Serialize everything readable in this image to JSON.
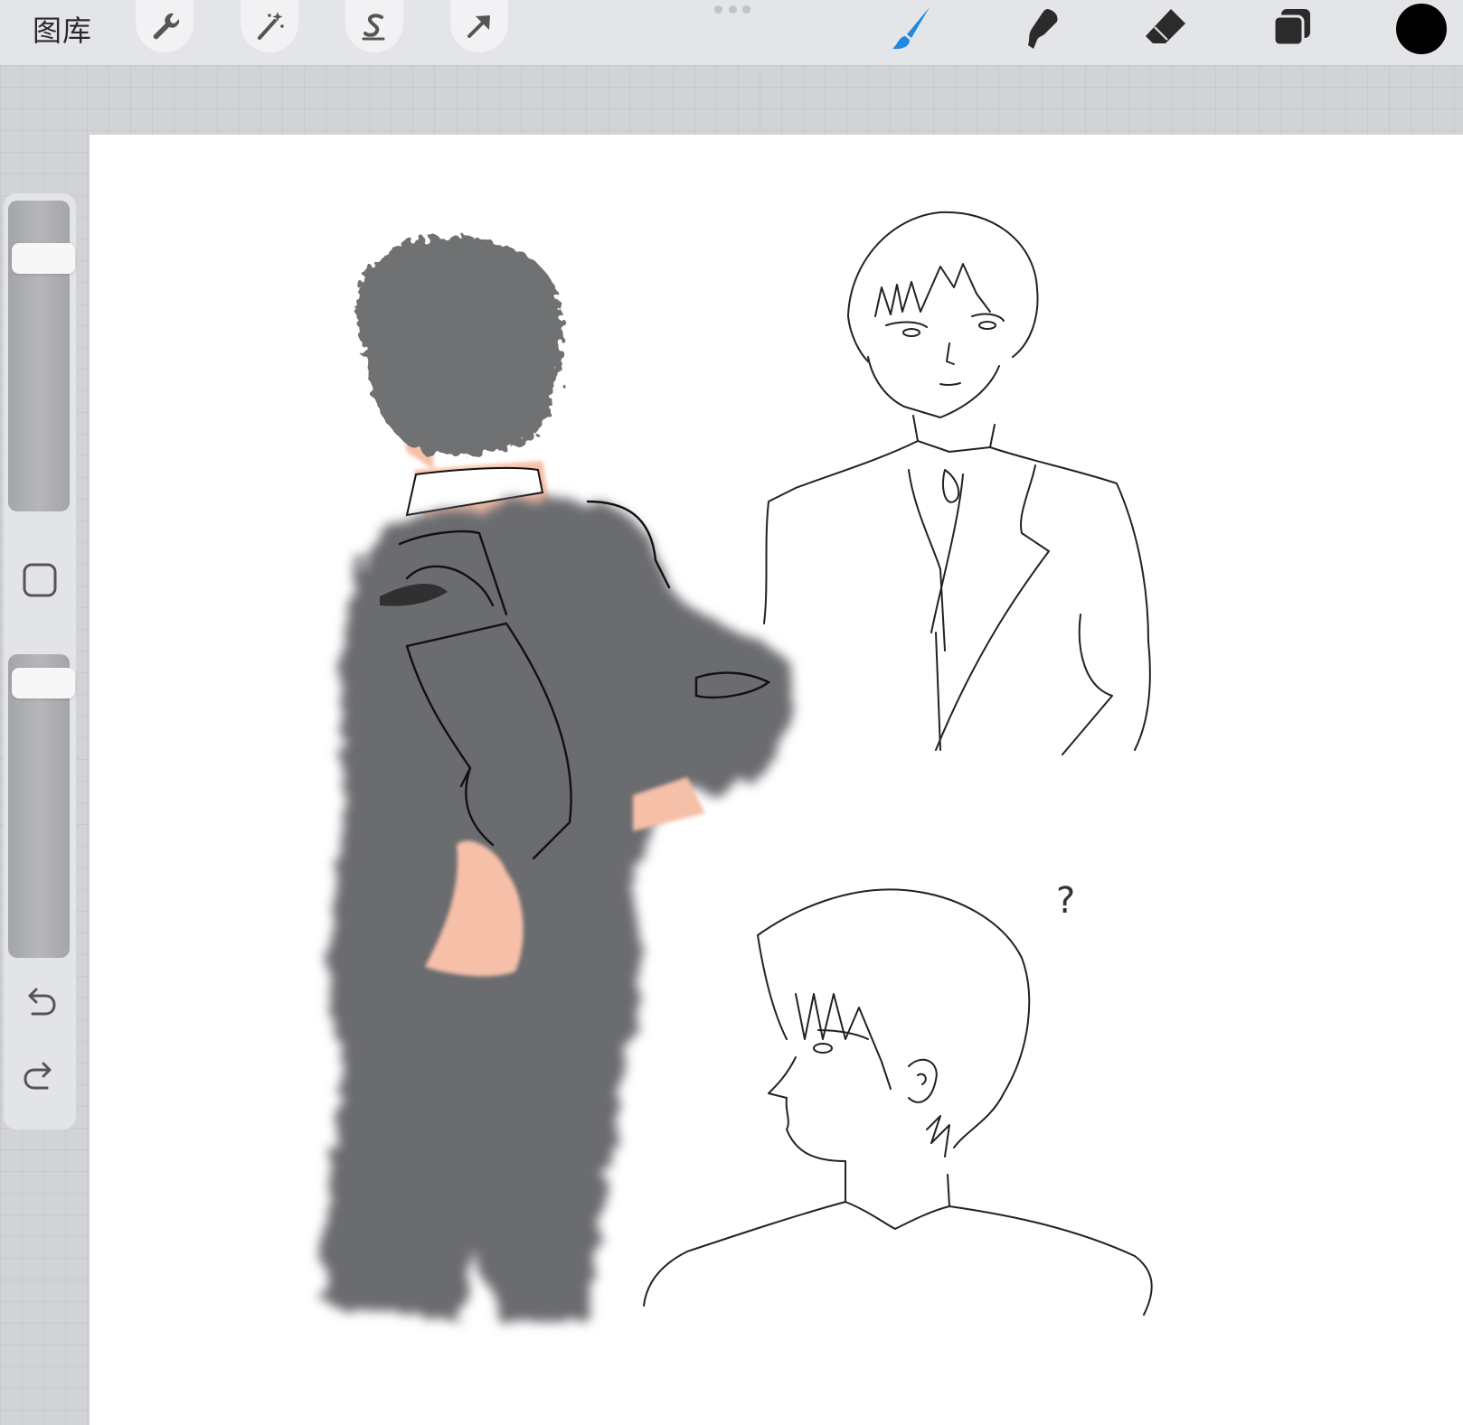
{
  "toolbar": {
    "gallery_label": "图库",
    "left_tools": [
      "wrench-icon",
      "magic-wand-icon",
      "selection-s-icon",
      "transform-arrow-icon"
    ],
    "right_tools": [
      "brush-icon",
      "smudge-icon",
      "eraser-icon",
      "layers-icon"
    ],
    "active_tool": "brush-icon"
  },
  "colors": {
    "active_tool": "#1e88e5",
    "current_color": "#000000",
    "suit": "#6b6c70",
    "hair": "#707172",
    "skin": "#f6c0a8"
  },
  "sidebar": {
    "brush_size_fraction": 0.85,
    "opacity_fraction": 0.95,
    "buttons": [
      "modify-square-icon",
      "undo-icon",
      "redo-icon"
    ]
  },
  "canvas": {
    "annotation_text": "?"
  }
}
